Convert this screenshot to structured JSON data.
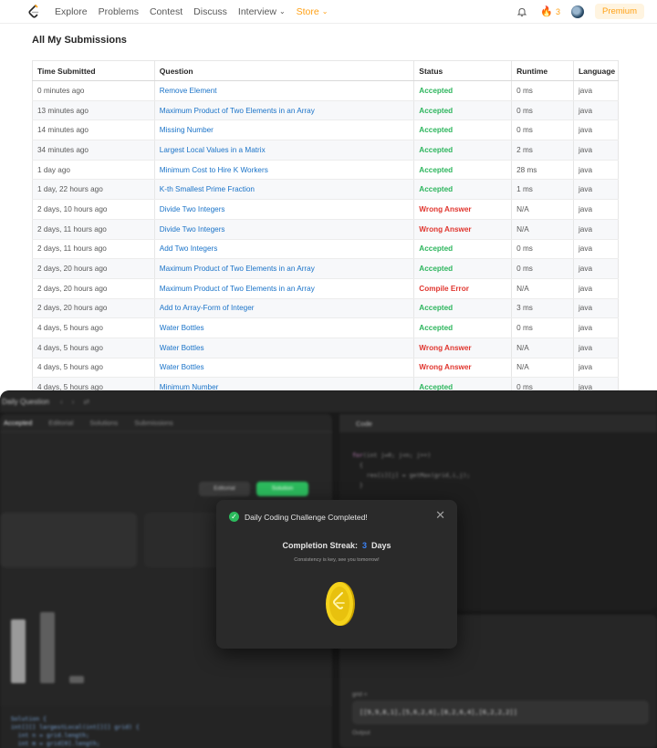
{
  "nav": {
    "items": [
      "Explore",
      "Problems",
      "Contest",
      "Discuss",
      "Interview",
      "Store"
    ],
    "streak_count": "3",
    "premium_label": "Premium"
  },
  "page": {
    "title": "All My Submissions"
  },
  "table": {
    "headers": [
      "Time Submitted",
      "Question",
      "Status",
      "Runtime",
      "Language"
    ],
    "rows": [
      {
        "time": "0 minutes ago",
        "question": "Remove Element",
        "status": "Accepted",
        "runtime": "0 ms",
        "language": "java"
      },
      {
        "time": "13 minutes ago",
        "question": "Maximum Product of Two Elements in an Array",
        "status": "Accepted",
        "runtime": "0 ms",
        "language": "java"
      },
      {
        "time": "14 minutes ago",
        "question": "Missing Number",
        "status": "Accepted",
        "runtime": "0 ms",
        "language": "java"
      },
      {
        "time": "34 minutes ago",
        "question": "Largest Local Values in a Matrix",
        "status": "Accepted",
        "runtime": "2 ms",
        "language": "java"
      },
      {
        "time": "1 day ago",
        "question": "Minimum Cost to Hire K Workers",
        "status": "Accepted",
        "runtime": "28 ms",
        "language": "java"
      },
      {
        "time": "1 day, 22 hours ago",
        "question": "K-th Smallest Prime Fraction",
        "status": "Accepted",
        "runtime": "1 ms",
        "language": "java"
      },
      {
        "time": "2 days, 10 hours ago",
        "question": "Divide Two Integers",
        "status": "Wrong Answer",
        "runtime": "N/A",
        "language": "java"
      },
      {
        "time": "2 days, 11 hours ago",
        "question": "Divide Two Integers",
        "status": "Wrong Answer",
        "runtime": "N/A",
        "language": "java"
      },
      {
        "time": "2 days, 11 hours ago",
        "question": "Add Two Integers",
        "status": "Accepted",
        "runtime": "0 ms",
        "language": "java"
      },
      {
        "time": "2 days, 20 hours ago",
        "question": "Maximum Product of Two Elements in an Array",
        "status": "Accepted",
        "runtime": "0 ms",
        "language": "java"
      },
      {
        "time": "2 days, 20 hours ago",
        "question": "Maximum Product of Two Elements in an Array",
        "status": "Compile Error",
        "runtime": "N/A",
        "language": "java"
      },
      {
        "time": "2 days, 20 hours ago",
        "question": "Add to Array-Form of Integer",
        "status": "Accepted",
        "runtime": "3 ms",
        "language": "java"
      },
      {
        "time": "4 days, 5 hours ago",
        "question": "Water Bottles",
        "status": "Accepted",
        "runtime": "0 ms",
        "language": "java"
      },
      {
        "time": "4 days, 5 hours ago",
        "question": "Water Bottles",
        "status": "Wrong Answer",
        "runtime": "N/A",
        "language": "java"
      },
      {
        "time": "4 days, 5 hours ago",
        "question": "Water Bottles",
        "status": "Wrong Answer",
        "runtime": "N/A",
        "language": "java"
      },
      {
        "time": "4 days, 5 hours ago",
        "question": "Minimum Number",
        "status": "Accepted",
        "runtime": "0 ms",
        "language": "java"
      }
    ]
  },
  "editor": {
    "top_label": "Daily Question",
    "tabs": [
      "Accepted",
      "Editorial",
      "Solutions",
      "Submissions"
    ],
    "editorial_btn": "Editorial",
    "solution_btn": "Solution",
    "code_tab": "Code",
    "input_label": "grid =",
    "input_value": "[[9,9,8,1],[5,6,2,6],[8,2,6,4],[6,2,2,2]]",
    "output_label": "Output",
    "output_value": "[[9,9],[8,6]]"
  },
  "modal": {
    "title": "Daily Coding Challenge Completed!",
    "streak_label": "Completion Streak:",
    "streak_value": "3",
    "streak_unit": "Days",
    "subtitle": "Consistency is key, see you tomorrow!"
  },
  "colors": {
    "accepted": "#2db55d",
    "error": "#e0362f",
    "link": "#1a73c8",
    "brand": "#ffa116"
  }
}
